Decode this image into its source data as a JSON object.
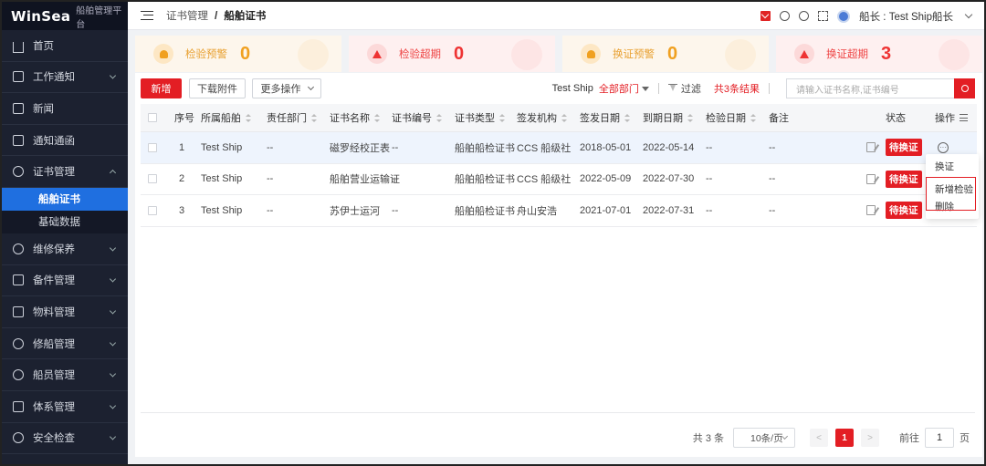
{
  "brand": {
    "name": "WinSea",
    "subtitle": "船舶管理平台"
  },
  "sidebar": {
    "items": [
      {
        "label": "首页",
        "icon": "home-icon",
        "expandable": false
      },
      {
        "label": "工作通知",
        "icon": "notice-icon",
        "expandable": true
      },
      {
        "label": "新闻",
        "icon": "news-icon",
        "expandable": false
      },
      {
        "label": "通知通函",
        "icon": "circular-icon",
        "expandable": false
      },
      {
        "label": "证书管理",
        "icon": "certificate-icon",
        "expandable": true,
        "expanded": true,
        "children": [
          {
            "label": "船舶证书",
            "active": true
          },
          {
            "label": "基础数据",
            "active": false
          }
        ]
      },
      {
        "label": "维修保养",
        "icon": "maintenance-icon",
        "expandable": true
      },
      {
        "label": "备件管理",
        "icon": "spare-parts-icon",
        "expandable": true
      },
      {
        "label": "物料管理",
        "icon": "material-icon",
        "expandable": true
      },
      {
        "label": "修船管理",
        "icon": "repair-icon",
        "expandable": true
      },
      {
        "label": "船员管理",
        "icon": "crew-icon",
        "expandable": true
      },
      {
        "label": "体系管理",
        "icon": "system-icon",
        "expandable": true
      },
      {
        "label": "安全检查",
        "icon": "safety-icon",
        "expandable": true
      }
    ]
  },
  "header": {
    "breadcrumb": [
      "证书管理",
      "船舶证书"
    ],
    "separator": "/",
    "user": "船长 : Test Ship船长"
  },
  "stats": [
    {
      "label": "检验预警",
      "value": "0",
      "tone": "warn"
    },
    {
      "label": "检验超期",
      "value": "0",
      "tone": "danger"
    },
    {
      "label": "换证预警",
      "value": "0",
      "tone": "warn"
    },
    {
      "label": "换证超期",
      "value": "3",
      "tone": "danger"
    }
  ],
  "toolbar": {
    "add_label": "新增",
    "download_label": "下载附件",
    "more_label": "更多操作",
    "ship": "Test Ship",
    "dept": "全部部门",
    "filter_label": "过滤",
    "result": "共3条结果",
    "search_placeholder": "请输入证书名称,证书编号"
  },
  "table": {
    "columns": [
      "序号",
      "所属船舶",
      "责任部门",
      "证书名称",
      "证书编号",
      "证书类型",
      "签发机构",
      "签发日期",
      "到期日期",
      "检验日期",
      "备注",
      "状态",
      "操作"
    ],
    "rows": [
      {
        "no": "1",
        "ship": "Test Ship",
        "dept": "--",
        "name": "磁罗经校正表",
        "code": "--",
        "type": "船舶船检证书",
        "issuer": "CCS 船级社",
        "issued": "2018-05-01",
        "expiry": "2022-05-14",
        "inspect": "--",
        "remark": "--",
        "status": "待换证"
      },
      {
        "no": "2",
        "ship": "Test Ship",
        "dept": "--",
        "name": "船舶营业运输证",
        "code": "--",
        "type": "船舶船检证书",
        "issuer": "CCS 船级社",
        "issued": "2022-05-09",
        "expiry": "2022-07-30",
        "inspect": "--",
        "remark": "--",
        "status": "待换证"
      },
      {
        "no": "3",
        "ship": "Test Ship",
        "dept": "--",
        "name": "苏伊士运河",
        "code": "--",
        "type": "船舶船检证书",
        "issuer": "舟山安浩",
        "issued": "2021-07-01",
        "expiry": "2022-07-31",
        "inspect": "--",
        "remark": "--",
        "status": "待换证"
      }
    ]
  },
  "row_menu": {
    "items": [
      "换证",
      "新增检验",
      "删除"
    ]
  },
  "pagination": {
    "total": "共 3 条",
    "page_size": "10条/页",
    "prev": "<",
    "current": "1",
    "next": ">",
    "goto_label": "前往",
    "goto_value": "1",
    "page_suffix": "页"
  },
  "colors": {
    "primary": "#e31e24",
    "sidebar": "#1c2130",
    "active": "#1f6fe0",
    "warn": "#f0a020"
  }
}
